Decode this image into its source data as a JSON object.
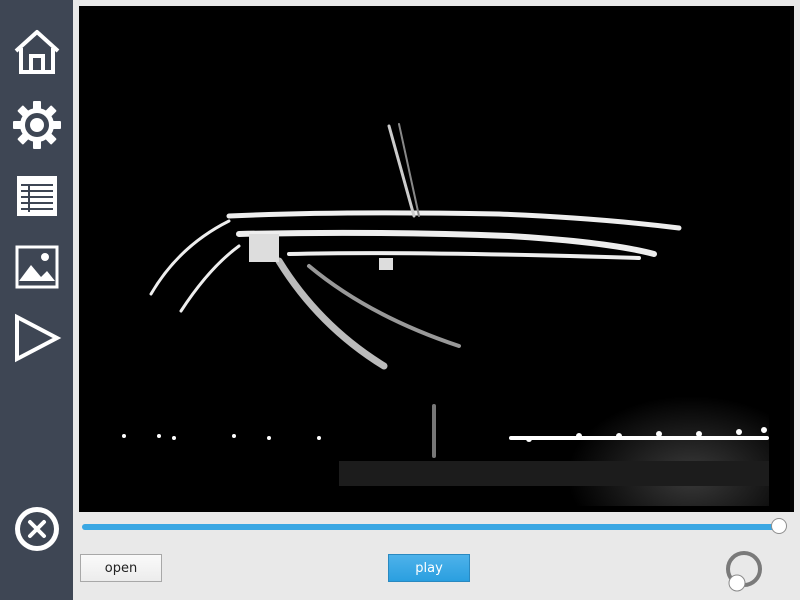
{
  "sidebar": {
    "items": [
      {
        "icon": "home-icon"
      },
      {
        "icon": "gear-icon"
      },
      {
        "icon": "list-icon"
      },
      {
        "icon": "image-icon"
      },
      {
        "icon": "play-icon"
      }
    ],
    "close_icon": "close-icon"
  },
  "player": {
    "progress_fraction": 0.99,
    "open_label": "open",
    "play_label": "play",
    "volume_knob": "volume-knob"
  },
  "colors": {
    "sidebar_bg": "#3e4654",
    "accent": "#3aa7e3",
    "background": "#e9e9e9"
  }
}
